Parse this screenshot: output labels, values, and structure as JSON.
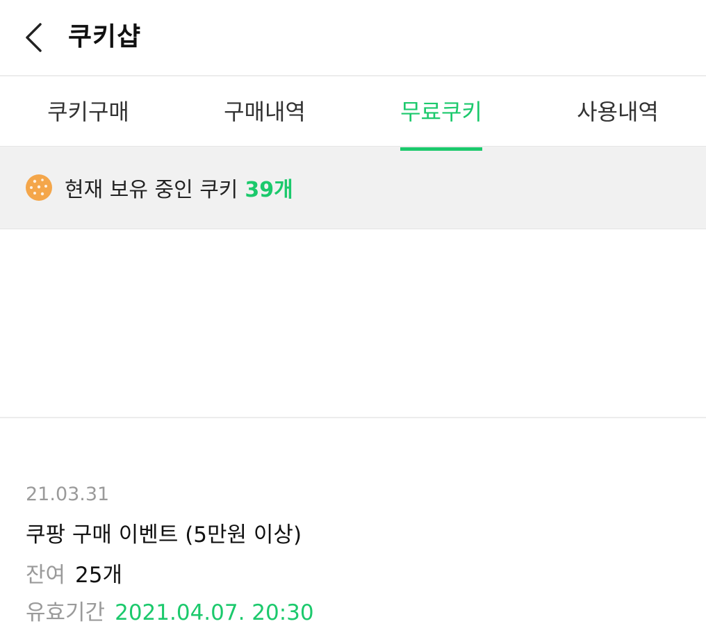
{
  "header": {
    "title": "쿠키샵"
  },
  "tabs": [
    {
      "label": "쿠키구매",
      "active": false
    },
    {
      "label": "구매내역",
      "active": false
    },
    {
      "label": "무료쿠키",
      "active": true
    },
    {
      "label": "사용내역",
      "active": false
    }
  ],
  "balance": {
    "label": "현재 보유 중인 쿠키",
    "count": "39개",
    "icon": "cookie-icon"
  },
  "entries": [
    {
      "date": "21.03.31",
      "title": "쿠팡 구매 이벤트 (5만원 이상)",
      "remain_label": "잔여",
      "remain_value": "25개",
      "valid_label": "유효기간",
      "valid_value": "2021.04.07. 20:30"
    }
  ],
  "colors": {
    "accent": "#1bc96c",
    "muted": "#9a9a9a",
    "band": "#f1f1f1"
  }
}
